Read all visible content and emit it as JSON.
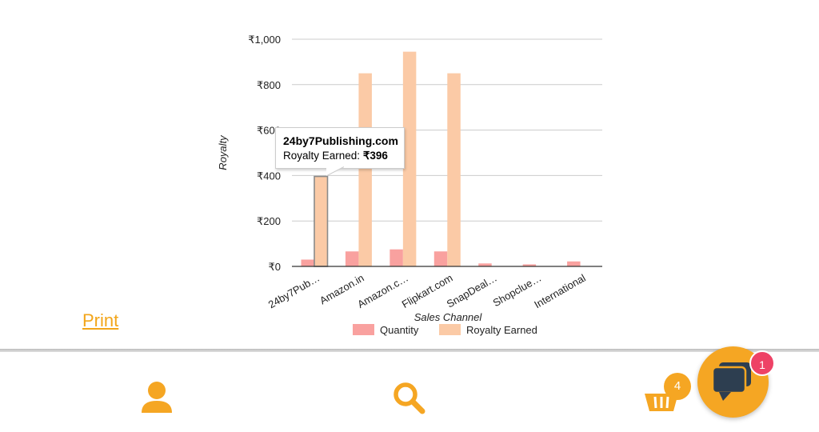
{
  "chart_data": {
    "type": "bar",
    "xlabel": "Sales Channel",
    "ylabel": "Royalty",
    "ylim": [
      0,
      1000
    ],
    "y_ticks": [
      0,
      200,
      400,
      600,
      800,
      1000
    ],
    "y_tick_labels": [
      "₹0",
      "₹200",
      "₹400",
      "₹600",
      "₹800",
      "₹1,000"
    ],
    "categories": [
      "24by7Pub…",
      "Amazon.in",
      "Amazon.c…",
      "Flipkart.com",
      "SnapDeal…",
      "Shopclue…",
      "International"
    ],
    "series": [
      {
        "name": "Quantity",
        "color": "#f9a19f",
        "values": [
          30,
          66,
          75,
          66,
          13,
          9,
          22
        ]
      },
      {
        "name": "Royalty Earned",
        "color": "#fbcaa6",
        "values": [
          396,
          850,
          945,
          850,
          0,
          0,
          0
        ]
      }
    ],
    "legend_position": "bottom",
    "grid": true
  },
  "tooltip": {
    "title": "24by7Publishing.com",
    "label": "Royalty Earned:",
    "value": "₹396"
  },
  "print_label": "Print",
  "nav": {
    "accent_color": "#f5a623",
    "items": [
      {
        "icon": "user-icon"
      },
      {
        "icon": "search-icon"
      },
      {
        "icon": "basket-icon",
        "badge": "4"
      }
    ]
  },
  "chat": {
    "icon": "chat-icon",
    "badge": "1"
  }
}
